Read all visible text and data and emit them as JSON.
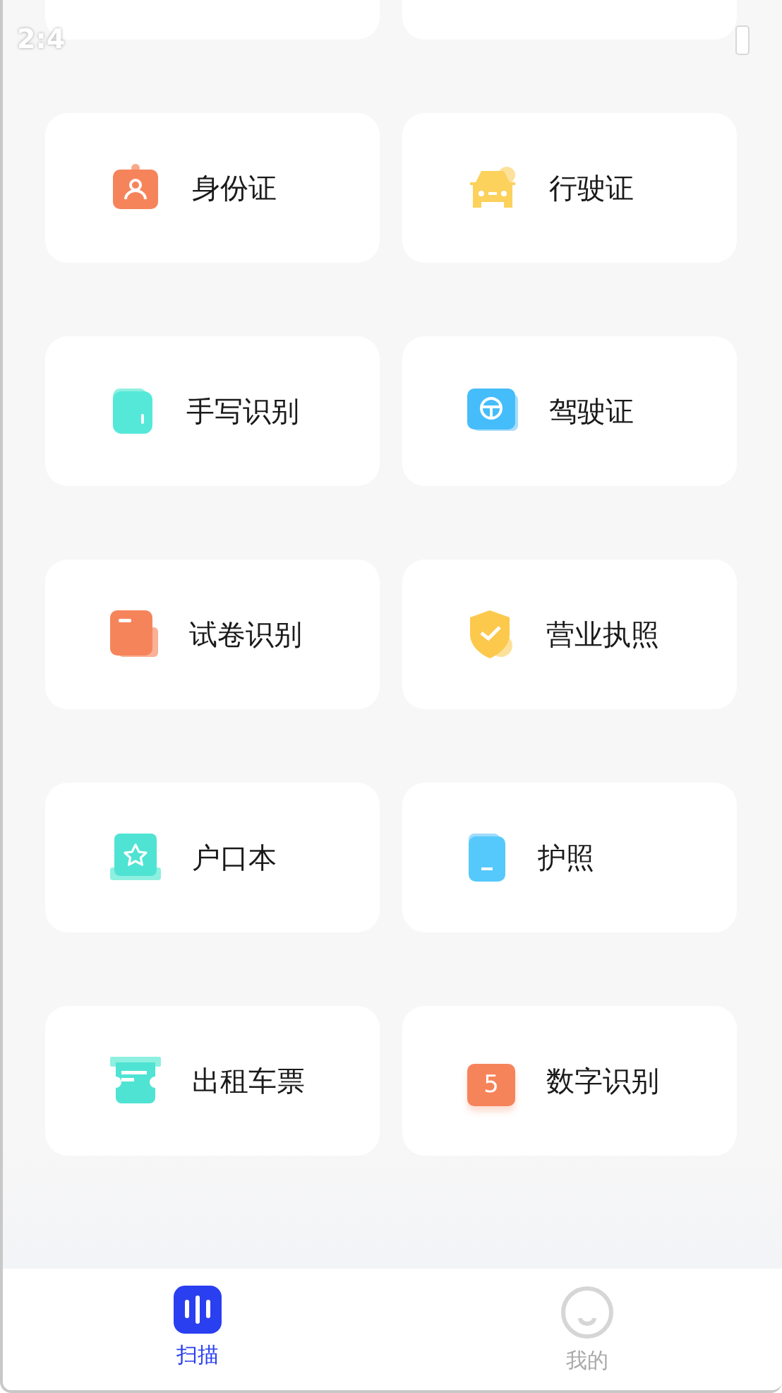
{
  "status_bar": {
    "time": "2:4"
  },
  "items": [
    {
      "kind": "cut"
    },
    {
      "kind": "cut"
    },
    {
      "kind": "card",
      "label": "身份证"
    },
    {
      "kind": "card",
      "label": "行驶证"
    },
    {
      "kind": "card",
      "label": "手写识别"
    },
    {
      "kind": "card",
      "label": "驾驶证"
    },
    {
      "kind": "card",
      "label": "试卷识别"
    },
    {
      "kind": "card",
      "label": "营业执照"
    },
    {
      "kind": "card",
      "label": "户口本"
    },
    {
      "kind": "card",
      "label": "护照"
    },
    {
      "kind": "card",
      "label": "出租车票"
    },
    {
      "kind": "card",
      "label": "数字识别",
      "icon_text": "5"
    }
  ],
  "tabs": [
    {
      "label": "扫描",
      "selected": true
    },
    {
      "label": "我的",
      "selected": false
    }
  ]
}
